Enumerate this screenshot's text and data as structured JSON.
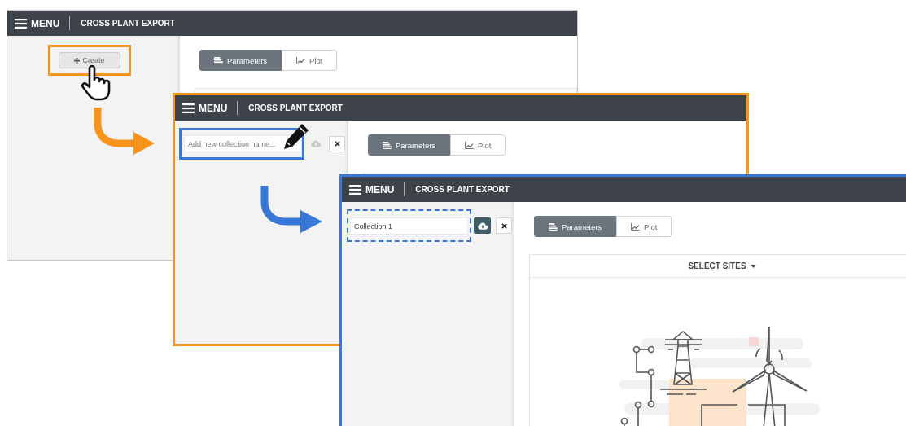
{
  "windows": [
    {
      "color": "#c8c8c8",
      "header": {
        "menu_label": "MENU",
        "title": "CROSS PLANT EXPORT"
      },
      "sidebar": {
        "kind": "create",
        "button_label": "Create",
        "highlight": {
          "kind": "solid",
          "color": "#f7941d"
        }
      },
      "tabs": [
        {
          "label": "Parameters",
          "kind": "parameters",
          "selected": true
        },
        {
          "label": "Plot",
          "kind": "plot",
          "selected": false
        }
      ]
    },
    {
      "color": "#f7941d",
      "header": {
        "menu_label": "MENU",
        "title": "CROSS PLANT EXPORT"
      },
      "sidebar": {
        "kind": "name-field",
        "field": {
          "placeholder": "Add new collection name..."
        },
        "save_disabled": true,
        "highlight": {
          "kind": "solid",
          "color": "#3a78d8"
        }
      },
      "tabs": [
        {
          "label": "Parameters",
          "kind": "parameters",
          "selected": true
        },
        {
          "label": "Plot",
          "kind": "plot",
          "selected": false
        }
      ]
    },
    {
      "color": "#3a78d8",
      "header": {
        "menu_label": "MENU",
        "title": "CROSS PLANT EXPORT"
      },
      "sidebar": {
        "kind": "name-field",
        "field": {
          "value": "Collection 1"
        },
        "save_disabled": false,
        "highlight": {
          "kind": "dashed",
          "color": "#3a78d8"
        }
      },
      "tabs": [
        {
          "label": "Parameters",
          "kind": "parameters",
          "selected": true
        },
        {
          "label": "Plot",
          "kind": "plot",
          "selected": false
        }
      ],
      "panel": {
        "title": "SELECT SITES"
      }
    }
  ]
}
